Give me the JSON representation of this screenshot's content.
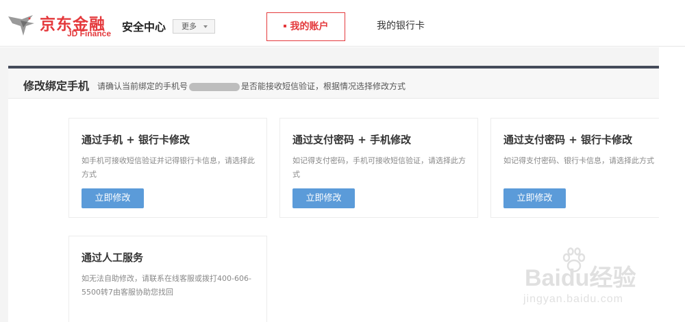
{
  "header": {
    "logo_cn": "京东金融",
    "logo_en": "JD Finance",
    "site_title": "安全中心",
    "more_label": "更多",
    "tabs": [
      {
        "label": "我的账户",
        "active": true
      },
      {
        "label": "我的银行卡",
        "active": false
      }
    ]
  },
  "panel": {
    "title": "修改绑定手机",
    "desc_before": "请确认当前绑定的手机号",
    "desc_after": "是否能接收短信验证，根据情况选择修改方式"
  },
  "cards": [
    {
      "title": "通过手机 + 银行卡修改",
      "desc": "如手机可接收短信验证并记得银行卡信息，请选择此方式",
      "button": "立即修改"
    },
    {
      "title": "通过支付密码 + 手机修改",
      "desc": "如记得支付密码，手机可接收短信验证，请选择此方式",
      "button": "立即修改"
    },
    {
      "title": "通过支付密码 + 银行卡修改",
      "desc": "如记得支付密码、银行卡信息，请选择此方式",
      "button": "立即修改"
    },
    {
      "title": "通过人工服务",
      "desc": "如无法自助修改，请联系在线客服或拨打400-606-5500转7由客服协助您找回"
    }
  ],
  "watermark": {
    "text": "Baidu经验",
    "url": "jingyan.baidu.com"
  },
  "colors": {
    "brand_red": "#e4393c",
    "button_blue": "#5b9bd9",
    "panel_border": "#444b5a"
  }
}
